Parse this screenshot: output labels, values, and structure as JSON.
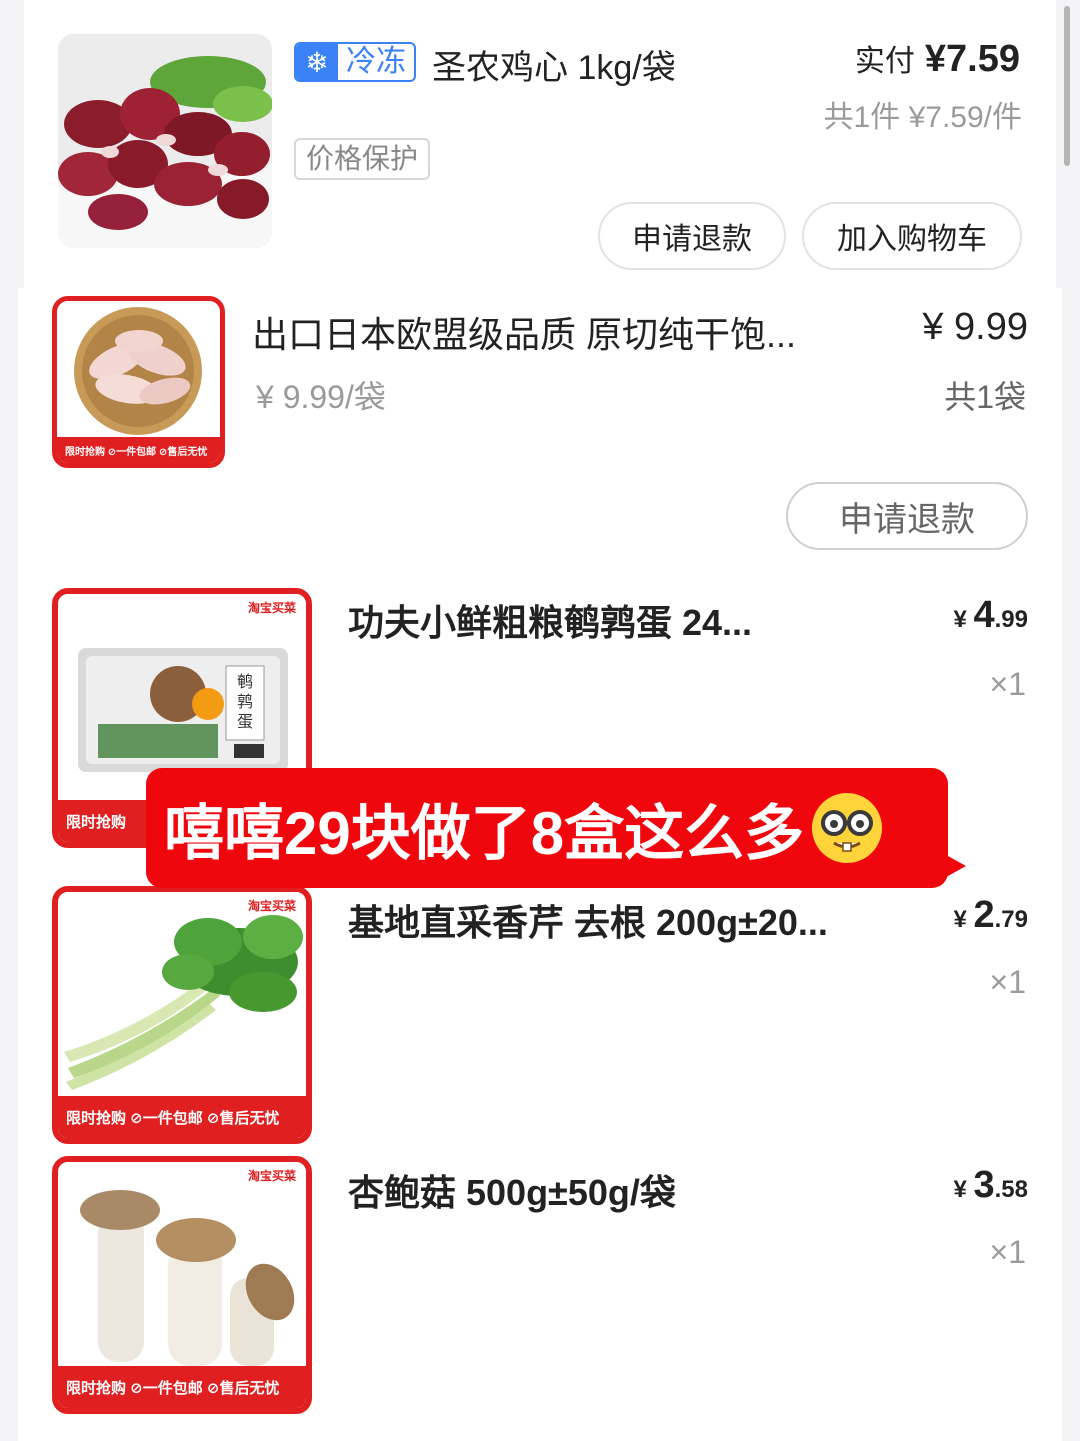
{
  "products": [
    {
      "tag_icon": "snowflake-icon",
      "tag_label": "冷冻",
      "title": "圣农鸡心 1kg/袋",
      "paid_label": "实付",
      "paid_amount": "¥7.59",
      "per_unit": "共1件 ¥7.59/件",
      "badge": "价格保护",
      "buttons": [
        "申请退款",
        "加入购物车"
      ]
    },
    {
      "title": "出口日本欧盟级品质 原切纯干饱...",
      "price": "¥ 9.99",
      "unit_price": "¥ 9.99/袋",
      "count": "共1袋",
      "button": "申请退款",
      "promo": "限时抢购  ⊘一件包邮 ⊘售后无忧"
    },
    {
      "title": "功夫小鲜粗粮鹌鹑蛋 24...",
      "price_symbol": "¥",
      "price_int": "4",
      "price_dec": ".99",
      "qty": "×1",
      "store": "淘宝买菜",
      "promo": "限时抢购"
    },
    {
      "title": "基地直采香芹 去根 200g±20...",
      "price_symbol": "¥",
      "price_int": "2",
      "price_dec": ".79",
      "qty": "×1",
      "store": "淘宝买菜",
      "promo": "限时抢购  ⊘一件包邮 ⊘售后无忧"
    },
    {
      "title": "杏鲍菇 500g±50g/袋",
      "price_symbol": "¥",
      "price_int": "3",
      "price_dec": ".58",
      "qty": "×1",
      "store": "淘宝买菜",
      "promo": "限时抢购  ⊘一件包邮 ⊘售后无忧"
    }
  ],
  "overlay_caption": "嘻嘻29块做了8盒这么多",
  "overlay_emoji": "nerd-face-emoji",
  "egg_box_label": "鹌鹑蛋",
  "colors": {
    "accent_red": "#e02020",
    "frozen_blue": "#3b82f6",
    "caption_red": "#f0070e"
  }
}
